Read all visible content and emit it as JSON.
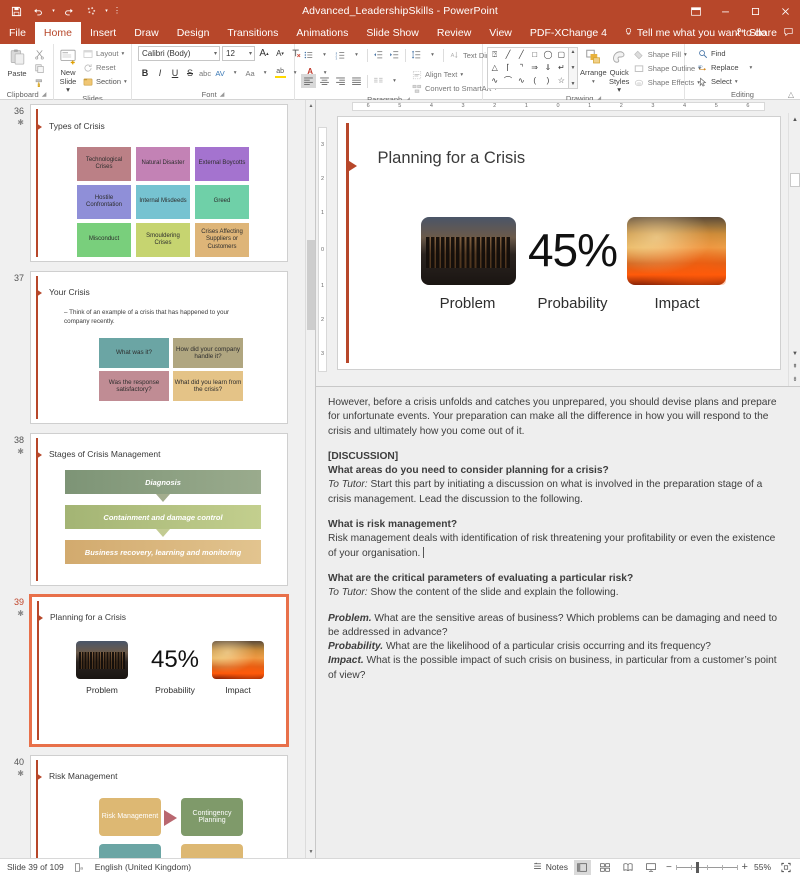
{
  "titlebar": {
    "app_title": "Advanced_LeadershipSkills  -  PowerPoint",
    "qat": [
      {
        "name": "save-icon",
        "label": "Save"
      },
      {
        "name": "undo-icon",
        "label": "Undo"
      },
      {
        "name": "redo-icon",
        "label": "Redo"
      },
      {
        "name": "start-slideshow-icon",
        "label": "Start From Beginning"
      },
      {
        "name": "customize-qat-icon",
        "label": "Customize Quick Access Toolbar"
      }
    ],
    "window_controls": [
      {
        "name": "ribbon-display-options-button",
        "label": "Ribbon Display Options"
      },
      {
        "name": "minimize-button",
        "label": "–"
      },
      {
        "name": "maximize-button",
        "label": "❐"
      },
      {
        "name": "close-button",
        "label": "✕"
      }
    ]
  },
  "tabs": [
    {
      "label": "File",
      "active": false
    },
    {
      "label": "Home",
      "active": true
    },
    {
      "label": "Insert",
      "active": false
    },
    {
      "label": "Draw",
      "active": false
    },
    {
      "label": "Design",
      "active": false
    },
    {
      "label": "Transitions",
      "active": false
    },
    {
      "label": "Animations",
      "active": false
    },
    {
      "label": "Slide Show",
      "active": false
    },
    {
      "label": "Review",
      "active": false
    },
    {
      "label": "View",
      "active": false
    },
    {
      "label": "PDF-XChange 4",
      "active": false
    }
  ],
  "tellme": {
    "label": "Tell me what you want to do",
    "icon": "lightbulb-icon"
  },
  "share": {
    "label": "Share",
    "icon": "share-person-icon",
    "comments_icon": "comments-icon"
  },
  "ribbon": {
    "clipboard": {
      "group_label": "Clipboard",
      "paste_label": "Paste",
      "cut_label": "Cut",
      "copy_label": "Copy",
      "format_painter_label": "Format Painter"
    },
    "slides": {
      "group_label": "Slides",
      "new_slide_label": "New\nSlide",
      "new_slide_line1": "New",
      "new_slide_line2": "Slide ▾",
      "layout_label": "Layout",
      "reset_label": "Reset",
      "section_label": "Section"
    },
    "font": {
      "group_label": "Font",
      "font_name": "Calibri (Body)",
      "font_size": "12",
      "grow_label": "A",
      "shrink_label": "A",
      "clear_formatting_label": "Clear All Formatting",
      "bold_label": "B",
      "italic_label": "I",
      "underline_label": "U",
      "strike_label": "S",
      "shadow_label": "abc",
      "spacing_label": "AV",
      "case_label": "Aa",
      "highlight_label": "ab",
      "color_label": "A"
    },
    "paragraph": {
      "group_label": "Paragraph",
      "text_direction_label": "Text Direction",
      "align_text_label": "Align Text",
      "convert_smartart_label": "Convert to SmartArt"
    },
    "drawing": {
      "group_label": "Drawing",
      "arrange_label": "Arrange",
      "quick_styles_line1": "Quick",
      "quick_styles_line2": "Styles ▾",
      "shape_fill_label": "Shape Fill",
      "shape_outline_label": "Shape Outline",
      "shape_effects_label": "Shape Effects",
      "shapes": [
        "▭",
        "╲",
        "╲",
        "▭",
        "◯",
        "▭",
        "△",
        "┐",
        "⤵",
        "⇨",
        "⇩",
        "↱",
        "✆",
        "⌒",
        "∿",
        "(",
        ")",
        "☆"
      ]
    },
    "editing": {
      "group_label": "Editing",
      "find_label": "Find",
      "replace_label": "Replace",
      "select_label": "Select",
      "collapse_ribbon_icon": "chevron-up-icon"
    }
  },
  "thumbnails": [
    {
      "number": "36",
      "has_animation": true,
      "selected": false,
      "title": "Types of Crisis",
      "boxes": [
        {
          "label": "Technological Crises",
          "color": "#bb8086"
        },
        {
          "label": "Natural Disaster",
          "color": "#c382b5"
        },
        {
          "label": "External Boycotts",
          "color": "#a473cf"
        },
        {
          "label": "Hostile Confrontation",
          "color": "#8f8fd8"
        },
        {
          "label": "Internal Misdeeds",
          "color": "#76c3d1"
        },
        {
          "label": "Greed",
          "color": "#6fd0a8"
        },
        {
          "label": "Misconduct",
          "color": "#79cf7c"
        },
        {
          "label": "Smouldering Crises",
          "color": "#c6d470"
        },
        {
          "label": "Crises Affecting Suppliers or Customers",
          "color": "#deb578"
        }
      ]
    },
    {
      "number": "37",
      "has_animation": false,
      "selected": false,
      "title": "Your Crisis",
      "bullet": "– Think of an example of a crisis that has happened to your company recently.",
      "boxes": [
        {
          "label": "What was it?",
          "color": "#6ba5a4"
        },
        {
          "label": "How did your company handle it?",
          "color": "#b0a680"
        },
        {
          "label": "Was the response satisfactory?",
          "color": "#c08c94"
        },
        {
          "label": "What did you learn from the crisis?",
          "color": "#e4c387"
        }
      ]
    },
    {
      "number": "38",
      "has_animation": true,
      "selected": false,
      "title": "Stages of Crisis Management",
      "stages": [
        {
          "label": "Diagnosis",
          "color1": "#7d9476",
          "color2": "#9aab8d"
        },
        {
          "label": "Containment and damage control",
          "color1": "#a3b474",
          "color2": "#c3cf8e"
        },
        {
          "label": "Business recovery, learning and monitoring",
          "color1": "#d2aa6e",
          "color2": "#e2c48f"
        }
      ]
    },
    {
      "number": "39",
      "has_animation": true,
      "selected": true,
      "title": "Planning for a Crisis",
      "items": [
        {
          "type": "photo",
          "name": "refinery-photo",
          "caption": "Problem"
        },
        {
          "type": "stat",
          "value": "45%",
          "caption": "Probability"
        },
        {
          "type": "photo",
          "name": "fire-photo",
          "caption": "Impact"
        }
      ]
    },
    {
      "number": "40",
      "has_animation": true,
      "selected": false,
      "title": "Risk Management",
      "boxes": [
        {
          "label": "Risk Management",
          "color": "#ddb873"
        },
        {
          "label": "Contingency Planning",
          "color": "#7f9a6a"
        }
      ]
    }
  ],
  "editor": {
    "h_ruler_ticks": [
      "6",
      "5",
      "4",
      "3",
      "2",
      "1",
      "0",
      "1",
      "2",
      "3",
      "4",
      "5",
      "6"
    ],
    "v_ruler_ticks": [
      "3",
      "2",
      "1",
      "0",
      "1",
      "2",
      "3"
    ],
    "slide": {
      "title": "Planning for a Crisis",
      "items": [
        {
          "type": "photo",
          "name": "refinery-photo",
          "caption": "Problem"
        },
        {
          "type": "stat",
          "value": "45%",
          "caption": "Probability"
        },
        {
          "type": "photo",
          "name": "fire-photo",
          "caption": "Impact"
        }
      ]
    }
  },
  "notes": {
    "paragraphs": [
      {
        "runs": [
          {
            "t": "However, before a crisis unfolds and catches you unprepared, you should devise plans and prepare for unfortunate events. Your preparation can make all the difference in how you will respond to the crisis and ultimately how you come out of it.",
            "s": "n"
          }
        ]
      },
      {
        "gap": true
      },
      {
        "runs": [
          {
            "t": "[DISCUSSION]",
            "s": "b"
          }
        ]
      },
      {
        "runs": [
          {
            "t": "What areas do you need to consider planning for a crisis?",
            "s": "b"
          }
        ]
      },
      {
        "runs": [
          {
            "t": "To Tutor:",
            "s": "i"
          },
          {
            "t": " Start this part by initiating a discussion on what is involved in the preparation stage of a crisis management. Lead the discussion to the following.",
            "s": "n"
          }
        ]
      },
      {
        "gap": true
      },
      {
        "runs": [
          {
            "t": "What is risk management?",
            "s": "b"
          }
        ]
      },
      {
        "runs": [
          {
            "t": "Risk management deals with identification of risk threatening your profitability or even the existence of your organisation.",
            "s": "n"
          }
        ],
        "caret": true
      },
      {
        "gap": true
      },
      {
        "runs": [
          {
            "t": "What are the critical parameters of evaluating a particular risk?",
            "s": "b"
          }
        ]
      },
      {
        "runs": [
          {
            "t": "To Tutor:",
            "s": "i"
          },
          {
            "t": " Show the content of the slide and explain the following.",
            "s": "n"
          }
        ]
      },
      {
        "gap": true
      },
      {
        "runs": [
          {
            "t": "Problem.",
            "s": "bi"
          },
          {
            "t": " What are the sensitive areas of business? Which problems can be damaging and need to be addressed in advance?",
            "s": "n"
          }
        ]
      },
      {
        "runs": [
          {
            "t": "Probability.",
            "s": "bi"
          },
          {
            "t": " What are the likelihood of a particular crisis occurring and its frequency?",
            "s": "n"
          }
        ]
      },
      {
        "runs": [
          {
            "t": "Impact.",
            "s": "bi"
          },
          {
            "t": " What is the possible impact of such crisis on business, in particular from a customer’s point of view?",
            "s": "n"
          }
        ]
      }
    ]
  },
  "statusbar": {
    "slide_indicator": "Slide 39 of 109",
    "accessibility_icon": "accessibility-checker-icon",
    "language": "English (United Kingdom)",
    "notes_label": "Notes",
    "notes_icon": "notes-icon",
    "views": [
      {
        "name": "normal-view-button",
        "label": "Normal",
        "active": true
      },
      {
        "name": "slide-sorter-button",
        "label": "Slide Sorter",
        "active": false
      },
      {
        "name": "reading-view-button",
        "label": "Reading View",
        "active": false
      },
      {
        "name": "slide-show-button",
        "label": "Slide Show",
        "active": false
      }
    ],
    "zoom_out_label": "−",
    "zoom_in_label": "+",
    "zoom_level": "55%",
    "fit_slide_icon": "fit-to-window-icon"
  },
  "colors": {
    "brand": "#b7472a",
    "selection": "#e8704a",
    "notes_bg": "#eeeeee"
  }
}
